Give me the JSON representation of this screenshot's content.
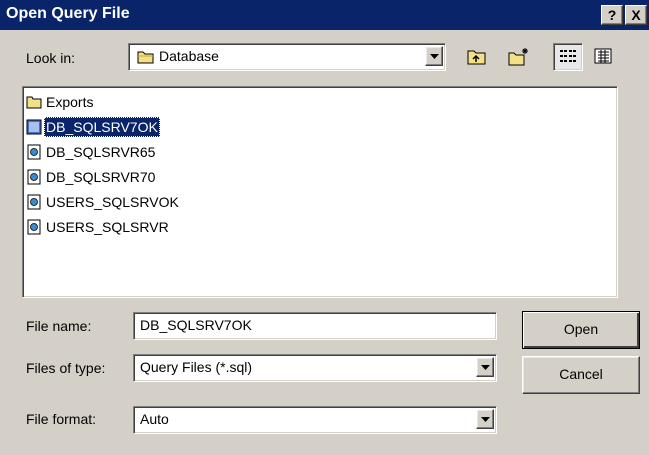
{
  "window": {
    "title": "Open Query File",
    "help_label": "?",
    "close_label": "X"
  },
  "look_in": {
    "label": "Look in:",
    "value": "Database"
  },
  "file_list": {
    "items": [
      {
        "name": "Exports",
        "type": "folder",
        "selected": false
      },
      {
        "name": "DB_SQLSRV7OK",
        "type": "query-file",
        "selected": true
      },
      {
        "name": "DB_SQLSRVR65",
        "type": "query-file",
        "selected": false
      },
      {
        "name": "DB_SQLSRVR70",
        "type": "query-file",
        "selected": false
      },
      {
        "name": "USERS_SQLSRVOK",
        "type": "query-file",
        "selected": false
      },
      {
        "name": "USERS_SQLSRVR",
        "type": "query-file",
        "selected": false
      }
    ]
  },
  "file_name": {
    "label": "File name:",
    "value": "DB_SQLSRV7OK"
  },
  "files_of_type": {
    "label": "Files of type:",
    "value": "Query Files (*.sql)"
  },
  "file_format": {
    "label": "File format:",
    "value": "Auto"
  },
  "buttons": {
    "open_label": "Open",
    "cancel_label": "Cancel"
  },
  "icons": {
    "folder": "folder-icon",
    "query_file": "query-file-icon",
    "up_folder": "up-one-level-icon",
    "new_folder": "new-folder-icon",
    "list_view": "list-view-icon",
    "details_view": "details-view-icon"
  },
  "colors": {
    "title_bar": "#0a246a",
    "dialog_face": "#d4d0c8",
    "selection": "#0a246a"
  }
}
